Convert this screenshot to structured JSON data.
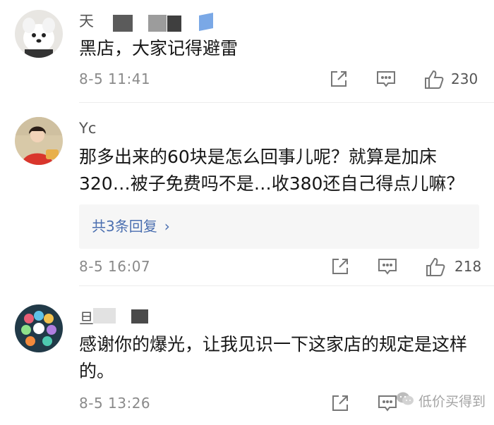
{
  "comments": [
    {
      "username": "天",
      "text": "黑店，大家记得避雷",
      "time": "8-5 11:41",
      "likes": "230"
    },
    {
      "username": "Yc",
      "text": "那多出来的60块是怎么回事儿呢？就算是加床320…被子免费吗不是…收380还自己得点儿嘛？",
      "reply_link": "共3条回复",
      "time": "8-5 16:07",
      "likes": "218"
    },
    {
      "username": "旦",
      "text": "感谢你的爆光，让我见识一下这家店的规定是这样的。",
      "time": "8-5 13:26",
      "likes": ""
    }
  ],
  "watermark": {
    "text": "低价买得到"
  },
  "icons": {
    "share": "share-icon",
    "comment": "comment-icon",
    "like": "thumbs-up-icon",
    "wechat": "wechat-icon"
  }
}
